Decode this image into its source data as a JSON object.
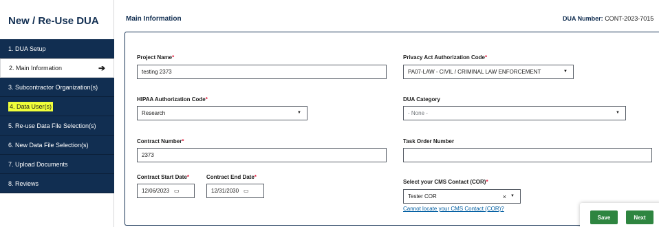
{
  "sidebar": {
    "title": "New / Re-Use DUA",
    "items": [
      {
        "label": "1. DUA Setup"
      },
      {
        "label": "2. Main Information",
        "arrow": "➔"
      },
      {
        "label": "3. Subcontractor Organization(s)"
      },
      {
        "label": "4. Data User(s)"
      },
      {
        "label": "5. Re-use Data File Selection(s)"
      },
      {
        "label": "6. New Data File Selection(s)"
      },
      {
        "label": "7. Upload Documents"
      },
      {
        "label": "8. Reviews"
      }
    ]
  },
  "header": {
    "title": "Main Information",
    "dua_number_label": "DUA Number:",
    "dua_number_value": "CONT-2023-7015"
  },
  "form": {
    "project_name": {
      "label": "Project Name",
      "required_mark": "*",
      "value": "testing 2373"
    },
    "privacy_code": {
      "label": "Privacy Act Authorization Code",
      "required_mark": "*",
      "value": "PA07-LAW - CIVIL / CRIMINAL LAW ENFORCEMENT"
    },
    "hipaa_code": {
      "label": "HIPAA Authorization Code",
      "required_mark": "*",
      "value": "Research"
    },
    "dua_category": {
      "label": "DUA Category",
      "value": "- None -"
    },
    "contract_number": {
      "label": "Contract Number",
      "required_mark": "*",
      "value": "2373"
    },
    "task_order_number": {
      "label": "Task Order Number",
      "value": ""
    },
    "contract_start_date": {
      "label": "Contract Start Date",
      "required_mark": "*",
      "value": "12/06/2023"
    },
    "contract_end_date": {
      "label": "Contract End Date",
      "required_mark": "*",
      "value": "12/31/2030"
    },
    "cms_contact": {
      "label": "Select your CMS Contact (COR)",
      "required_mark": "*",
      "value": "Tester COR",
      "clear": "×"
    },
    "cms_contact_link": "Cannot locate your CMS Contact (COR)?"
  },
  "footer": {
    "save_label": "Save",
    "next_label": "Next"
  },
  "colors": {
    "nav_bg": "#112e51",
    "required": "#e31c3d",
    "button_green": "#2e8540",
    "link": "#005ea2",
    "highlight": "#f0ff3a"
  }
}
